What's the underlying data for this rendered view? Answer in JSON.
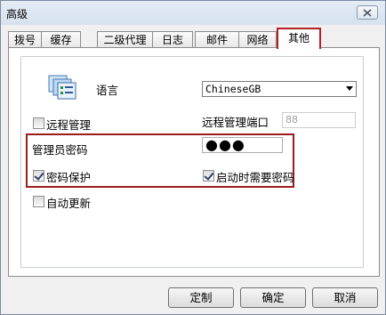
{
  "window": {
    "title": "高级"
  },
  "tabs": [
    {
      "label": "拨号"
    },
    {
      "label": "缓存"
    },
    {
      "label": "二级代理"
    },
    {
      "label": "日志"
    },
    {
      "label": "邮件"
    },
    {
      "label": "网络"
    },
    {
      "label": "其他",
      "active": true
    }
  ],
  "language": {
    "label": "语言",
    "value": "ChineseGB"
  },
  "remote": {
    "manage_label": "远程管理",
    "manage_checked": false,
    "port_label": "远程管理端口",
    "port_value": "88"
  },
  "admin": {
    "password_label": "管理员密码",
    "password_value": "●●●"
  },
  "protect": {
    "password_protect_label": "密码保护",
    "password_protect_checked": true,
    "startup_label": "启动时需要密码",
    "startup_checked": true
  },
  "update": {
    "auto_label": "自动更新",
    "auto_checked": false
  },
  "buttons": {
    "customize": "定制",
    "ok": "确定",
    "cancel": "取消"
  },
  "colors": {
    "highlight": "#9b1c1c"
  }
}
